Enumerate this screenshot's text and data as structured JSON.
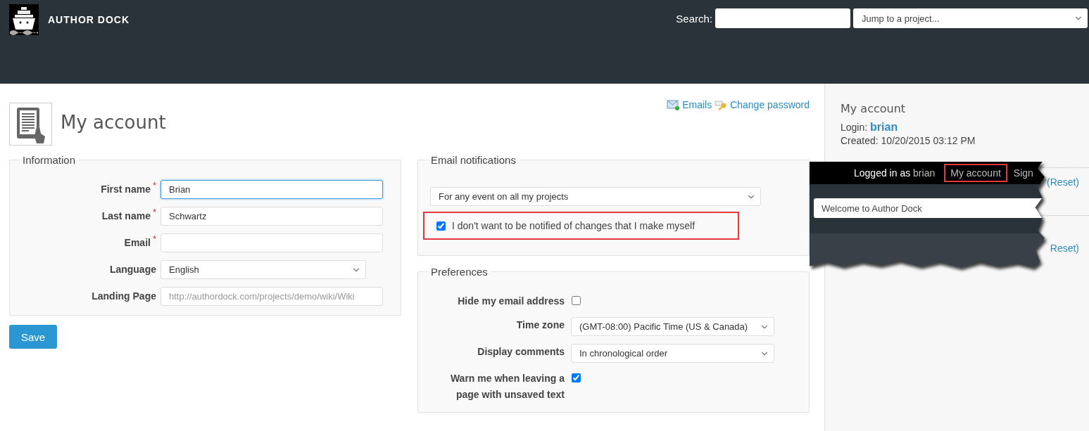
{
  "header": {
    "app_name": "AUTHOR DOCK",
    "search_label": "Search:",
    "project_jump": "Jump to a project..."
  },
  "page": {
    "title": "My account",
    "links": [
      {
        "kind": "emails",
        "label": "Emails"
      },
      {
        "kind": "password",
        "label": "Change password"
      }
    ]
  },
  "information": {
    "legend": "Information",
    "fields": [
      {
        "kind": "input",
        "label": "First name",
        "required_mark": "*",
        "value": "Brian",
        "focused": true
      },
      {
        "kind": "input",
        "label": "Last name",
        "required_mark": "*",
        "value": "Schwartz",
        "focused": false
      },
      {
        "kind": "input",
        "label": "Email",
        "required_mark": "*",
        "focused": false
      },
      {
        "kind": "select",
        "label": "Language",
        "value": "English"
      },
      {
        "kind": "input",
        "label": "Landing Page",
        "placeholder": "http://authordock.com/projects/demo/wiki/Wiki",
        "focused": false
      }
    ]
  },
  "save_button": "Save",
  "email_notifications": {
    "legend": "Email notifications",
    "option": "For any event on all my projects",
    "self_changes": {
      "label": "I don't want to be notified of changes that I make myself",
      "checked": true,
      "highlighted": true
    }
  },
  "preferences": {
    "legend": "Preferences",
    "rows": [
      {
        "kind": "checkbox",
        "label": "Hide my email address",
        "checked": false
      },
      {
        "kind": "select",
        "label": "Time zone",
        "value": "(GMT-08:00) Pacific Time (US & Canada)"
      },
      {
        "kind": "select",
        "label": "Display comments",
        "value": "In chronological order"
      },
      {
        "kind": "checkbox",
        "label": "Warn me when leaving a page with unsaved text",
        "checked": true
      }
    ]
  },
  "sidebar": {
    "title": "My account",
    "login_label": "Login:",
    "login": "brian",
    "created": "Created: 10/20/2015 03:12 PM",
    "reset_links": [
      "(Reset)",
      "Reset)"
    ]
  },
  "inset": {
    "logged_in_label": "Logged in as",
    "user": "brian",
    "menu": [
      {
        "label": "My account",
        "highlighted": true
      },
      {
        "label": "Sign",
        "highlighted": false
      }
    ],
    "project_select": "Welcome to Author Dock"
  }
}
